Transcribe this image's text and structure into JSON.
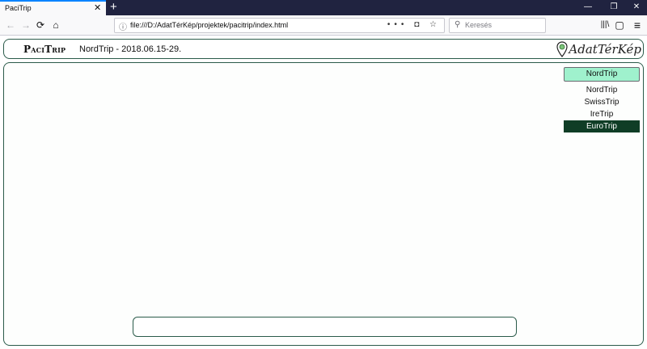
{
  "browser": {
    "tab_title": "PaciTrip",
    "tab_close": "✕",
    "new_tab": "+",
    "window_min": "—",
    "window_restore": "❐",
    "window_close": "✕",
    "back": "←",
    "forward": "→",
    "reload": "⟳",
    "home": "⌂",
    "url_info": "ⓘ",
    "url": "file:///D:/AdatTérKép/projektek/pacitrip/index.html",
    "url_actions": "••• ◘ ☆",
    "search_placeholder": "Keresés",
    "library": "|||\\",
    "sidebar": "▢",
    "menu": "≡"
  },
  "app": {
    "logo": "PaciTrip",
    "trip_title": "NordTrip - 2018.06.15-29.",
    "brand": "AdatTérKép"
  },
  "trip_menu": {
    "selected": "NordTrip",
    "items": [
      {
        "label": "NordTrip",
        "active": false
      },
      {
        "label": "SwissTrip",
        "active": false
      },
      {
        "label": "IreTrip",
        "active": false
      },
      {
        "label": "EuroTrip",
        "active": true
      }
    ]
  },
  "colors": {
    "accent": "#9ff1cd",
    "active_item": "#0f3d26",
    "border": "#2b5b4a"
  }
}
